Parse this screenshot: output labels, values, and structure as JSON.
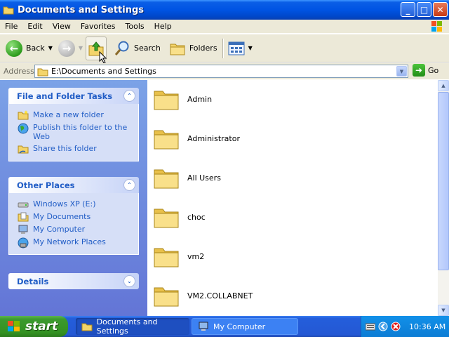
{
  "window": {
    "title": "Documents and Settings",
    "buttons": [
      "_",
      "□",
      "✕"
    ]
  },
  "menu": [
    "File",
    "Edit",
    "View",
    "Favorites",
    "Tools",
    "Help"
  ],
  "toolbar": {
    "back_label": "Back",
    "search_label": "Search",
    "folders_label": "Folders"
  },
  "address": {
    "label": "Address",
    "value": "E:\\Documents and Settings",
    "go_label": "Go"
  },
  "taskpane": {
    "file_tasks": {
      "title": "File and Folder Tasks",
      "items": [
        "Make a new folder",
        "Publish this folder to the Web",
        "Share this folder"
      ]
    },
    "other_places": {
      "title": "Other Places",
      "items": [
        "Windows XP (E:)",
        "My Documents",
        "My Computer",
        "My Network Places"
      ]
    },
    "details": {
      "title": "Details"
    }
  },
  "folders": [
    "Admin",
    "Administrator",
    "All Users",
    "choc",
    "vm2",
    "VM2.COLLABNET"
  ],
  "taskbar": {
    "start_label": "start",
    "buttons": [
      "Documents and Settings",
      "My Computer"
    ],
    "clock": "10:36 AM"
  },
  "colors": {
    "title_blue": "#0054e3",
    "taskpane_blue": "#6375d6",
    "link_blue": "#215dc6",
    "start_green": "#339122"
  }
}
